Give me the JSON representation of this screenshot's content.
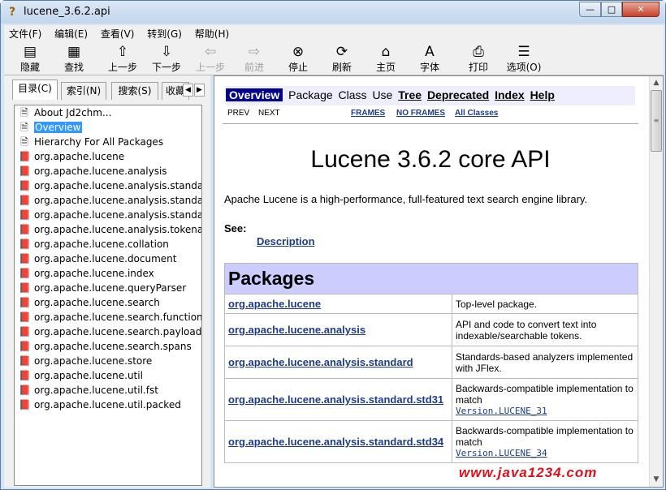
{
  "window": {
    "title": "lucene_3.6.2.api",
    "app_icon": "help-question-icon",
    "controls": {
      "minimize": "—",
      "maximize": "□",
      "close": "✕"
    }
  },
  "menu": [
    "文件(F)",
    "编辑(E)",
    "查看(V)",
    "转到(G)",
    "帮助(H)"
  ],
  "toolbar": [
    {
      "label": "隐藏",
      "icon": "hide-pane-icon",
      "glyph": "▤",
      "enabled": true
    },
    {
      "label": "查找",
      "icon": "find-icon",
      "glyph": "▦",
      "enabled": true
    },
    {
      "label": "上一步",
      "icon": "up-arrow-icon",
      "glyph": "⇧",
      "enabled": true
    },
    {
      "label": "下一步",
      "icon": "down-arrow-icon",
      "glyph": "⇩",
      "enabled": true
    },
    {
      "label": "上一步",
      "icon": "back-arrow-icon",
      "glyph": "⇦",
      "enabled": false
    },
    {
      "label": "前进",
      "icon": "forward-arrow-icon",
      "glyph": "⇨",
      "enabled": false
    },
    {
      "label": "停止",
      "icon": "stop-icon",
      "glyph": "⊗",
      "enabled": true
    },
    {
      "label": "刷新",
      "icon": "refresh-icon",
      "glyph": "⟳",
      "enabled": true
    },
    {
      "label": "主页",
      "icon": "home-icon",
      "glyph": "⌂",
      "enabled": true
    },
    {
      "label": "字体",
      "icon": "font-icon",
      "glyph": "A",
      "enabled": true
    },
    {
      "label": "打印",
      "icon": "print-icon",
      "glyph": "⎙",
      "enabled": true
    },
    {
      "label": "选项(O)",
      "icon": "options-icon",
      "glyph": "☰",
      "enabled": true
    }
  ],
  "tabs": {
    "contents": "目录(C)",
    "index": "索引(N)",
    "search": "搜索(S)",
    "favorites": "收藏"
  },
  "tree": [
    {
      "label": "About Jd2chm...",
      "icon": "document-icon",
      "selected": false
    },
    {
      "label": "Overview",
      "icon": "document-icon",
      "selected": true
    },
    {
      "label": "Hierarchy For All Packages",
      "icon": "document-icon",
      "selected": false
    },
    {
      "label": "org.apache.lucene",
      "icon": "book-icon",
      "selected": false
    },
    {
      "label": "org.apache.lucene.analysis",
      "icon": "book-icon",
      "selected": false
    },
    {
      "label": "org.apache.lucene.analysis.standard",
      "icon": "book-icon",
      "selected": false
    },
    {
      "label": "org.apache.lucene.analysis.standard",
      "icon": "book-icon",
      "selected": false
    },
    {
      "label": "org.apache.lucene.analysis.standard",
      "icon": "book-icon",
      "selected": false
    },
    {
      "label": "org.apache.lucene.analysis.tokenattr",
      "icon": "book-icon",
      "selected": false
    },
    {
      "label": "org.apache.lucene.collation",
      "icon": "book-icon",
      "selected": false
    },
    {
      "label": "org.apache.lucene.document",
      "icon": "book-icon",
      "selected": false
    },
    {
      "label": "org.apache.lucene.index",
      "icon": "book-icon",
      "selected": false
    },
    {
      "label": "org.apache.lucene.queryParser",
      "icon": "book-icon",
      "selected": false
    },
    {
      "label": "org.apache.lucene.search",
      "icon": "book-icon",
      "selected": false
    },
    {
      "label": "org.apache.lucene.search.function",
      "icon": "book-icon",
      "selected": false
    },
    {
      "label": "org.apache.lucene.search.payloads",
      "icon": "book-icon",
      "selected": false
    },
    {
      "label": "org.apache.lucene.search.spans",
      "icon": "book-icon",
      "selected": false
    },
    {
      "label": "org.apache.lucene.store",
      "icon": "book-icon",
      "selected": false
    },
    {
      "label": "org.apache.lucene.util",
      "icon": "book-icon",
      "selected": false
    },
    {
      "label": "org.apache.lucene.util.fst",
      "icon": "book-icon",
      "selected": false
    },
    {
      "label": "org.apache.lucene.util.packed",
      "icon": "book-icon",
      "selected": false
    }
  ],
  "content": {
    "nav": {
      "overview": "Overview",
      "package": "Package",
      "class": "Class",
      "use": "Use",
      "tree": "Tree",
      "deprecated": "Deprecated",
      "index": "Index",
      "help": "Help"
    },
    "subnav": {
      "prev": "PREV",
      "next": "NEXT",
      "frames": "FRAMES",
      "no_frames": "NO FRAMES",
      "all_classes": "All Classes"
    },
    "title": "Lucene 3.6.2 core API",
    "description": "Apache Lucene is a high-performance, full-featured text search engine library.",
    "see_label": "See:",
    "see_link": "Description",
    "packages_header": "Packages",
    "packages": [
      {
        "name": "org.apache.lucene",
        "desc": "Top-level package.",
        "code": ""
      },
      {
        "name": "org.apache.lucene.analysis",
        "desc": "API and code to convert text into indexable/searchable tokens.",
        "code": ""
      },
      {
        "name": "org.apache.lucene.analysis.standard",
        "desc": "Standards-based analyzers implemented with JFlex.",
        "code": ""
      },
      {
        "name": "org.apache.lucene.analysis.standard.std31",
        "desc": "Backwards-compatible implementation to match",
        "code": "Version.LUCENE_31"
      },
      {
        "name": "org.apache.lucene.analysis.standard.std34",
        "desc": "Backwards-compatible implementation to match",
        "code": "Version.LUCENE_34"
      }
    ]
  },
  "watermark": "www.java1234.com"
}
